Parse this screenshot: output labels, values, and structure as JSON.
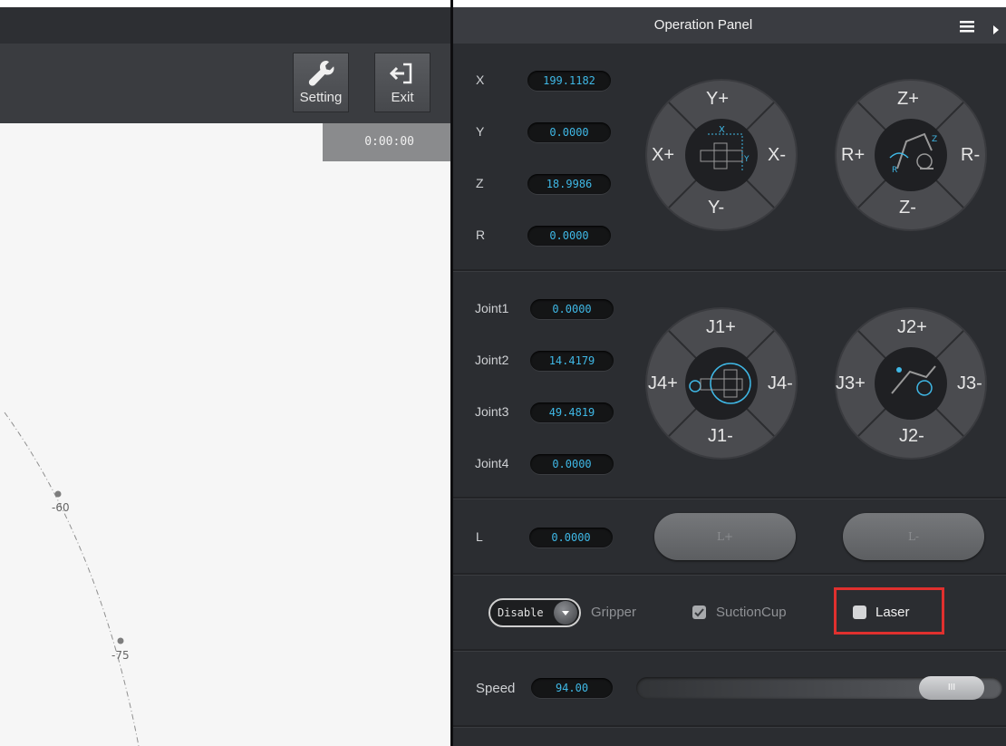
{
  "toolbar": {
    "setting_label": "Setting",
    "exit_label": "Exit",
    "timer": "0:00:00"
  },
  "canvas": {
    "tick_labels": [
      "-60",
      "-75"
    ]
  },
  "panel": {
    "title": "Operation Panel"
  },
  "cartesian": {
    "fields": [
      {
        "label": "X",
        "value": "199.1182"
      },
      {
        "label": "Y",
        "value": "0.0000"
      },
      {
        "label": "Z",
        "value": "18.9986"
      },
      {
        "label": "R",
        "value": "0.0000"
      }
    ],
    "xy_pad": {
      "up": "Y+",
      "down": "Y-",
      "left": "X+",
      "right": "X-"
    },
    "zr_pad": {
      "up": "Z+",
      "down": "Z-",
      "left": "R+",
      "right": "R-"
    }
  },
  "joints": {
    "fields": [
      {
        "label": "Joint1",
        "value": "0.0000"
      },
      {
        "label": "Joint2",
        "value": "14.4179"
      },
      {
        "label": "Joint3",
        "value": "49.4819"
      },
      {
        "label": "Joint4",
        "value": "0.0000"
      }
    ],
    "j14_pad": {
      "up": "J1+",
      "down": "J1-",
      "left": "J4+",
      "right": "J4-"
    },
    "j23_pad": {
      "up": "J2+",
      "down": "J2-",
      "left": "J3+",
      "right": "J3-"
    }
  },
  "linear": {
    "label": "L",
    "value": "0.0000",
    "plus": "L+",
    "minus": "L-"
  },
  "end_effector": {
    "mode": "Disable",
    "gripper": "Gripper",
    "suction": "SuctionCup",
    "laser": "Laser",
    "suction_checked": true,
    "laser_checked": false
  },
  "speed": {
    "label": "Speed",
    "value": "94.00",
    "percent": 94
  },
  "colors": {
    "accent": "#3fb8e6",
    "highlight": "#e0302e"
  }
}
